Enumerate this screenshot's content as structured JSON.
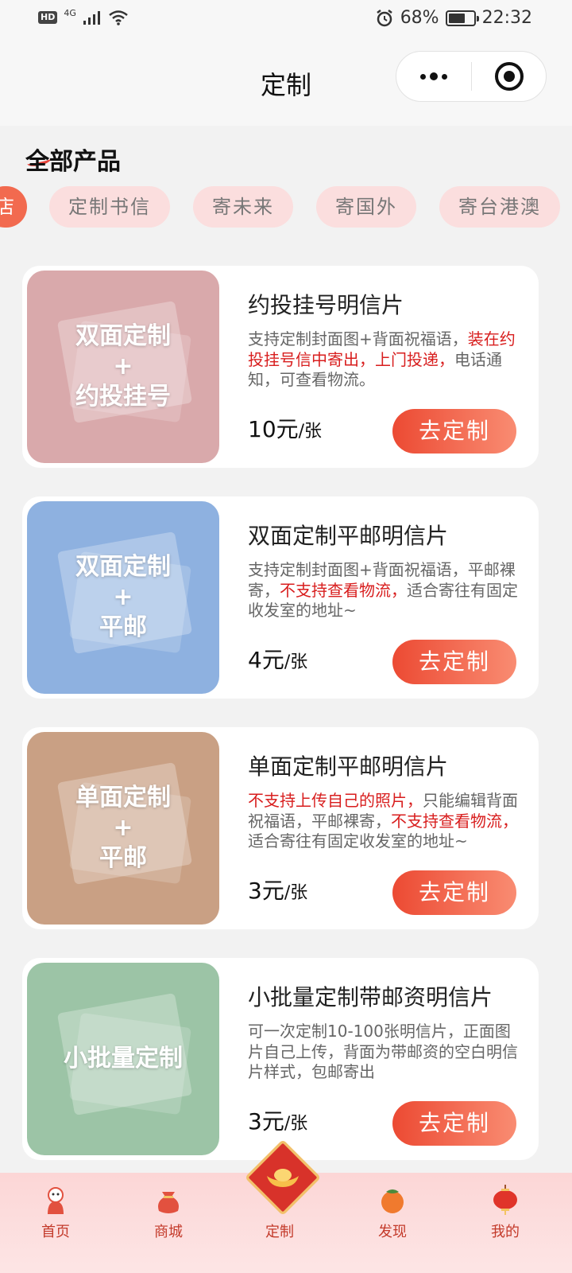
{
  "status_bar": {
    "hd": "HD",
    "network": "4G",
    "battery_percent": "68%",
    "battery_level": 0.68,
    "time": "22:32"
  },
  "header": {
    "title": "定制"
  },
  "section": {
    "title": "全部产品"
  },
  "chips": [
    {
      "label": "店",
      "active": true
    },
    {
      "label": "定制书信",
      "active": false
    },
    {
      "label": "寄未来",
      "active": false
    },
    {
      "label": "寄国外",
      "active": false
    },
    {
      "label": "寄台港澳",
      "active": false
    }
  ],
  "products": [
    {
      "thumb_text": "双面定制\n+\n约投挂号",
      "thumb_color": "#d9a9ab",
      "name": "约投挂号明信片",
      "desc": [
        {
          "text": "支持定制封面图+背面祝福语，",
          "hl": false
        },
        {
          "text": "装在约投挂号信中寄出，上门投递，",
          "hl": true
        },
        {
          "text": "电话通知，可查看物流。",
          "hl": false
        }
      ],
      "price": "10元",
      "unit": "/张",
      "button": "去定制"
    },
    {
      "thumb_text": "双面定制\n+\n平邮",
      "thumb_color": "#8eb1e0",
      "name": "双面定制平邮明信片",
      "desc": [
        {
          "text": "支持定制封面图+背面祝福语，平邮裸寄，",
          "hl": false
        },
        {
          "text": "不支持查看物流，",
          "hl": true
        },
        {
          "text": "适合寄往有固定收发室的地址~",
          "hl": false
        }
      ],
      "price": "4元",
      "unit": "/张",
      "button": "去定制"
    },
    {
      "thumb_text": "单面定制\n+\n平邮",
      "thumb_color": "#c9a084",
      "name": "单面定制平邮明信片",
      "desc": [
        {
          "text": "不支持上传自己的照片，",
          "hl": true
        },
        {
          "text": "只能编辑背面祝福语，平邮裸寄，",
          "hl": false
        },
        {
          "text": "不支持查看物流，",
          "hl": true
        },
        {
          "text": "适合寄往有固定收发室的地址~",
          "hl": false
        }
      ],
      "price": "3元",
      "unit": "/张",
      "button": "去定制"
    },
    {
      "thumb_text": "小批量定制",
      "thumb_color": "#9cc4a6",
      "name": "小批量定制带邮资明信片",
      "desc": [
        {
          "text": "可一次定制10-100张明信片，正面图片自己上传，背面为带邮资的空白明信片样式，包邮寄出",
          "hl": false
        }
      ],
      "price": "3元",
      "unit": "/张",
      "button": "去定制"
    }
  ],
  "tabbar": {
    "items": [
      {
        "label": "首页",
        "icon": "mascot-icon"
      },
      {
        "label": "商城",
        "icon": "lucky-bag-icon"
      },
      {
        "label": "定制",
        "icon": "gold-ingot-icon"
      },
      {
        "label": "发现",
        "icon": "persimmon-icon"
      },
      {
        "label": "我的",
        "icon": "lantern-icon"
      }
    ]
  },
  "colors": {
    "accent": "#f26a4f",
    "highlight": "#d81e1e",
    "chip_bg": "#fbdede"
  }
}
